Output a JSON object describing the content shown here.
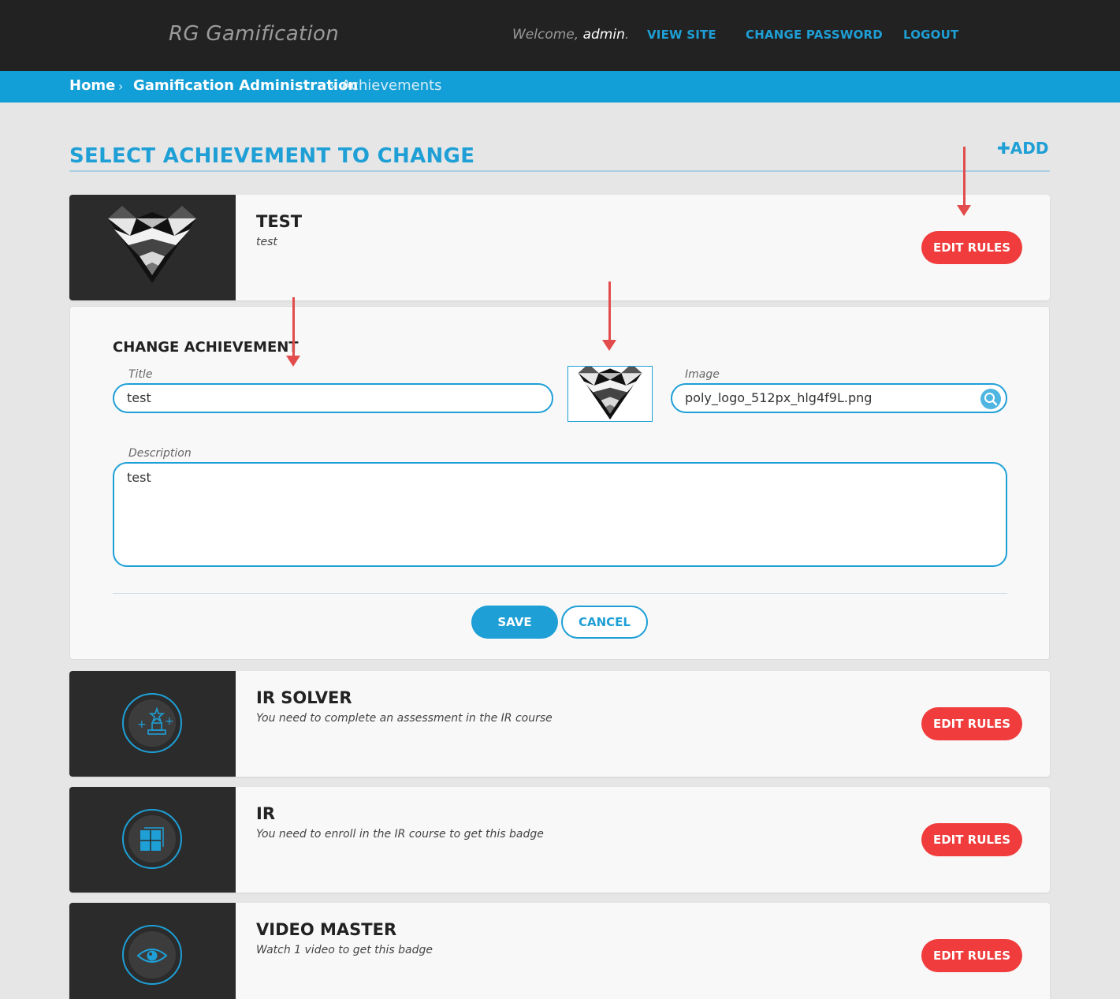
{
  "header": {
    "brand": "RG Gamification",
    "welcome_prefix": "Welcome, ",
    "username": "admin",
    "welcome_suffix": ".",
    "links": {
      "view_site": "VIEW SITE",
      "change_password": "CHANGE PASSWORD",
      "logout": "LOGOUT"
    }
  },
  "breadcrumb": {
    "home": "Home",
    "sep": "›",
    "section": "Gamification Administration",
    "current": "Achievements"
  },
  "page": {
    "title": "SELECT ACHIEVEMENT TO CHANGE",
    "add_label": "ADD",
    "add_icon": "plus-icon"
  },
  "achievements": [
    {
      "title": "TEST",
      "description": "test",
      "icon": "poly-logo-image",
      "button": "EDIT RULES"
    },
    {
      "title": "IR SOLVER",
      "description": "You need to complete an assessment in the IR course",
      "icon": "trophy-badge-icon",
      "button": "EDIT RULES"
    },
    {
      "title": "IR",
      "description": "You need to enroll in the IR course to get this badge",
      "icon": "window-badge-icon",
      "button": "EDIT RULES"
    },
    {
      "title": "VIDEO MASTER",
      "description": "Watch 1 video to get this badge",
      "icon": "eye-badge-icon",
      "button": "EDIT RULES"
    }
  ],
  "edit_form": {
    "heading": "CHANGE ACHIEVEMENT",
    "title_label": "Title",
    "title_value": "test",
    "image_label": "Image",
    "image_value": "poly_logo_512px_hlg4f9L.png",
    "description_label": "Description",
    "description_value": "test",
    "save": "SAVE",
    "cancel": "CANCEL"
  },
  "colors": {
    "header_bg": "#222222",
    "accent": "#1e9fd6",
    "danger": "#f03c3c",
    "annotation": "#e24c4c"
  }
}
